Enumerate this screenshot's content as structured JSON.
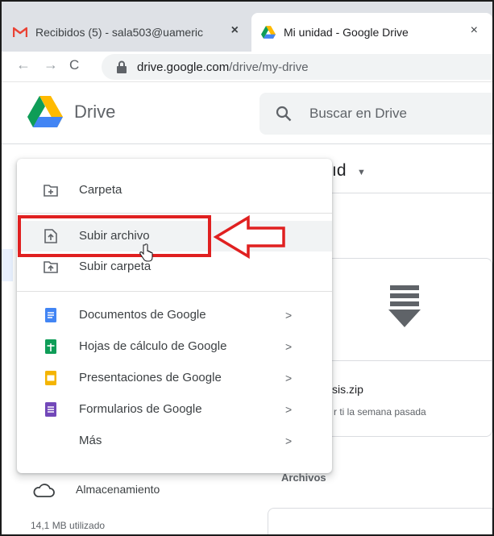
{
  "browser": {
    "tabs": [
      {
        "title": "Recibidos (5) - sala503@uameric",
        "favicon": "gmail-icon",
        "active": false
      },
      {
        "title": "Mi unidad - Google Drive",
        "favicon": "drive-icon",
        "active": true
      }
    ],
    "close_glyph": "×",
    "back_glyph": "←",
    "forward_glyph": "→",
    "reload_glyph": "C",
    "url_host": "drive.google.com",
    "url_path": "/drive/my-drive"
  },
  "header": {
    "app_name": "Drive",
    "search_placeholder": "Buscar en Drive"
  },
  "background": {
    "page_title_fragment": "ıd",
    "title_caret": "▼",
    "file_name_fragment": "sis.zip",
    "file_subtitle_fragment": "r ti la semana pasada",
    "files_heading": "Archivos",
    "storage_label": "Almacenamiento",
    "storage_used": "14,1 MB utilizado"
  },
  "new_menu": {
    "items": [
      {
        "label": "Carpeta",
        "icon": "new-folder-icon"
      },
      {
        "label": "Subir archivo",
        "icon": "file-upload-icon",
        "hovered": true
      },
      {
        "label": "Subir carpeta",
        "icon": "folder-upload-icon"
      },
      {
        "label": "Documentos de Google",
        "icon": "docs-icon",
        "chevron": ">"
      },
      {
        "label": "Hojas de cálculo de Google",
        "icon": "sheets-icon",
        "chevron": ">"
      },
      {
        "label": "Presentaciones de Google",
        "icon": "slides-icon",
        "chevron": ">"
      },
      {
        "label": "Formularios de Google",
        "icon": "forms-icon",
        "chevron": ">"
      },
      {
        "label": "Más",
        "icon": "",
        "chevron": ">"
      }
    ]
  },
  "colors": {
    "docs": "#4285f4",
    "sheets": "#0f9d58",
    "slides": "#f4b400",
    "forms": "#7248b9",
    "annotation": "#e02020"
  }
}
